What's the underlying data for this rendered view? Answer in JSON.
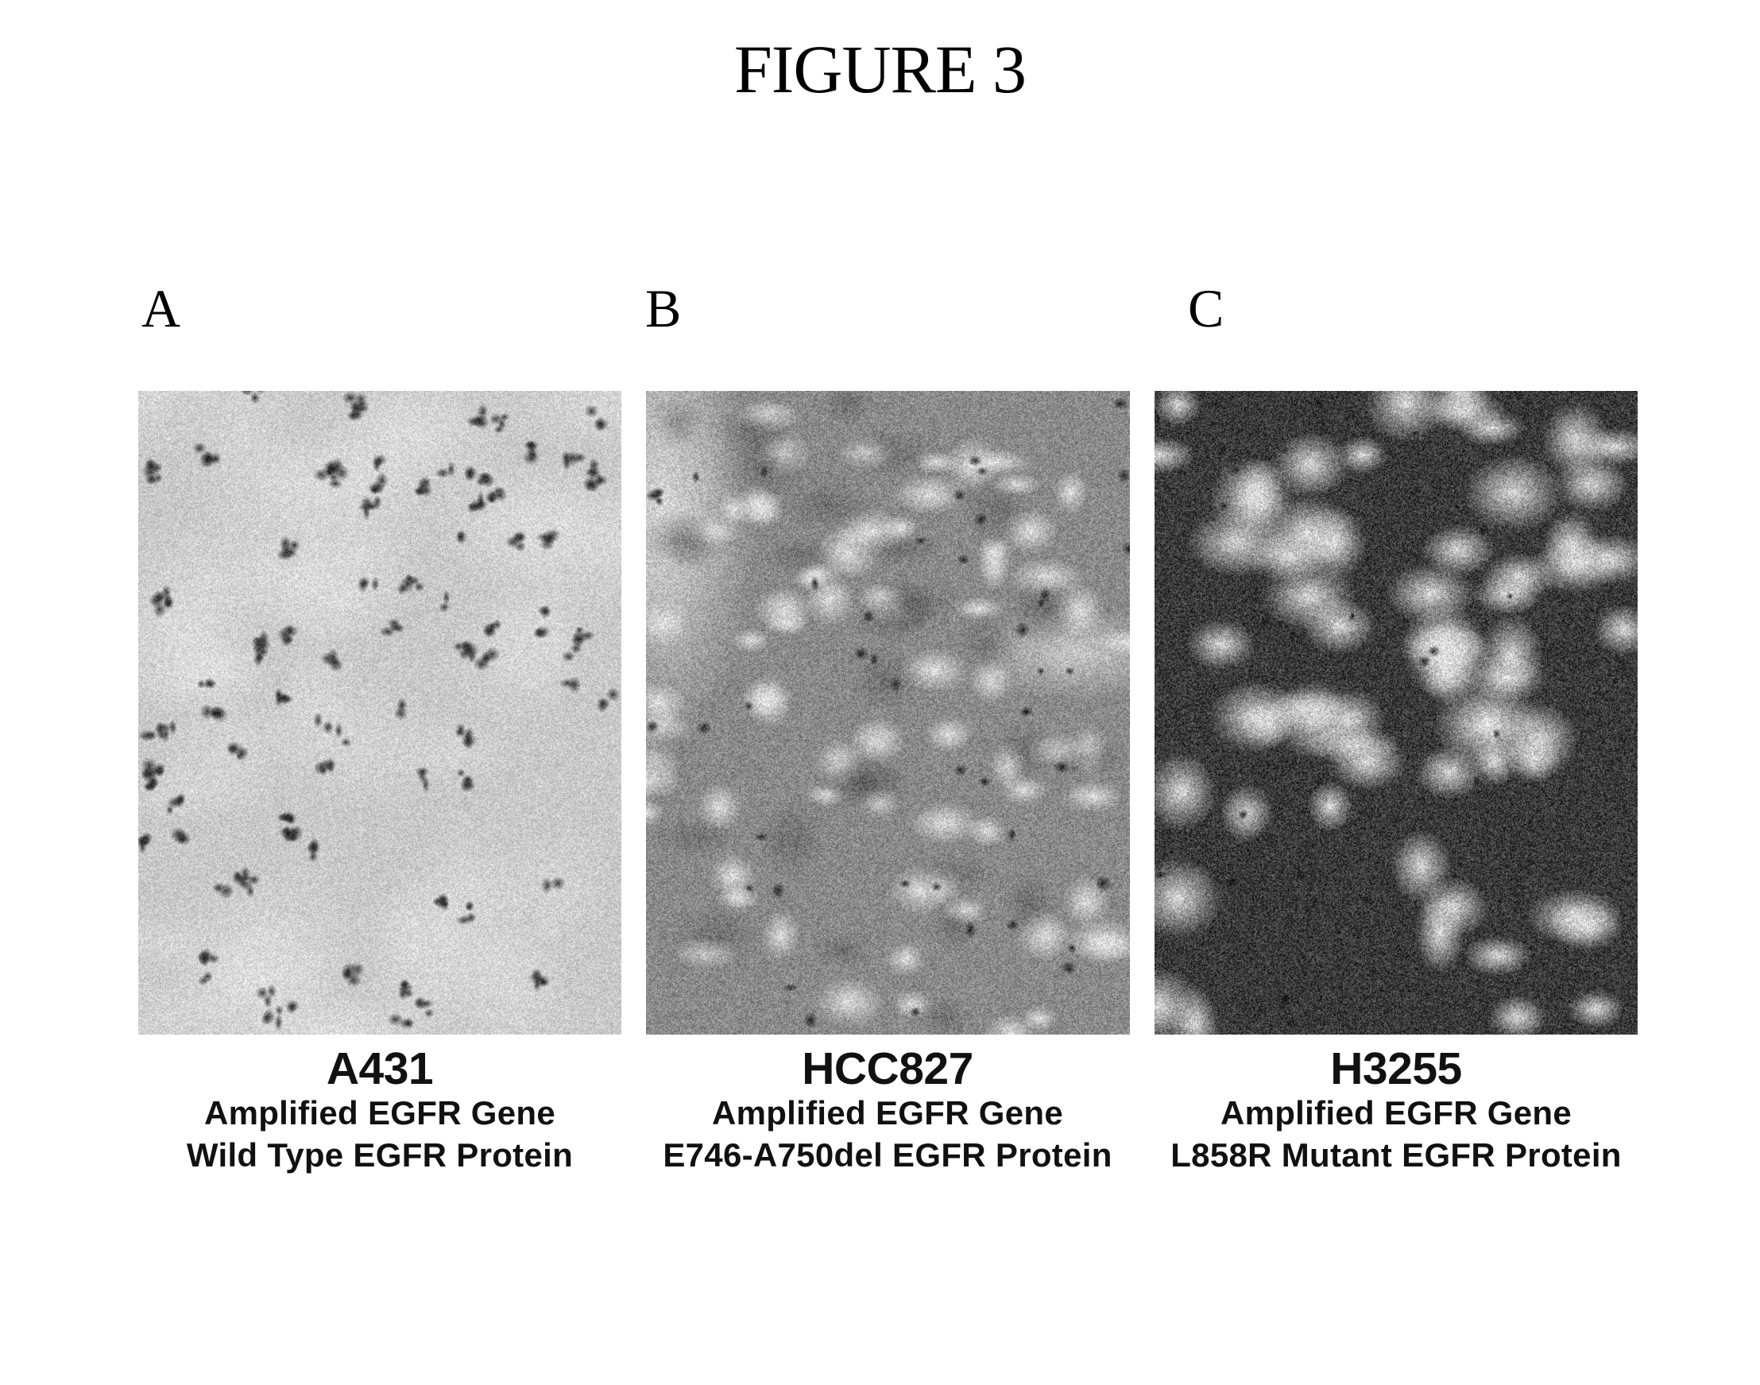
{
  "figure": {
    "title": "FIGURE 3",
    "panels": [
      {
        "letter": "A",
        "cell_line": "A431",
        "gene": "Amplified EGFR Gene",
        "protein": "Wild Type EGFR Protein",
        "image_description": "IHC micrograph, light staining with scattered dark punctate dots"
      },
      {
        "letter": "B",
        "cell_line": "HCC827",
        "gene": "Amplified EGFR Gene",
        "protein": "E746-A750del EGFR Protein",
        "image_description": "IHC micrograph, moderate diffuse staining with pale nuclei"
      },
      {
        "letter": "C",
        "cell_line": "H3255",
        "gene": "Amplified EGFR Gene",
        "protein": "L858R Mutant EGFR Protein",
        "image_description": "IHC micrograph, strong dark membranous staining"
      }
    ]
  }
}
